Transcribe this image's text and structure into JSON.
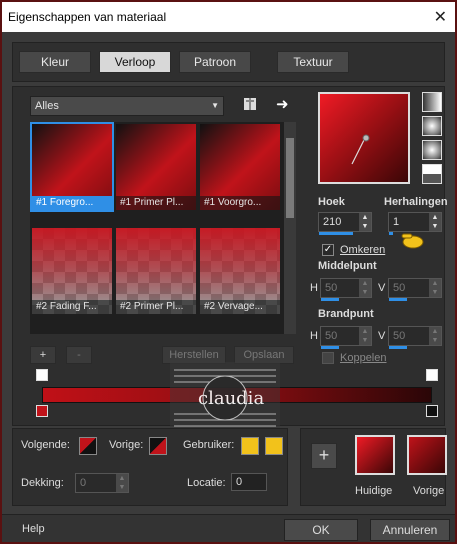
{
  "window": {
    "title": "Eigenschappen van materiaal",
    "close": "✕"
  },
  "tabs": [
    {
      "label": "Kleur"
    },
    {
      "label": "Verloop"
    },
    {
      "label": "Patroon"
    },
    {
      "label": "Textuur"
    }
  ],
  "filter": {
    "selected": "Alles"
  },
  "gradients": [
    {
      "caption": "#1 Foregro..."
    },
    {
      "caption": "#1 Primer Pl..."
    },
    {
      "caption": "#1 Voorgro..."
    },
    {
      "caption": "#2 Fading F..."
    },
    {
      "caption": "#2 Primer Pl..."
    },
    {
      "caption": "#2 Vervage..."
    }
  ],
  "list_buttons": {
    "add": "+",
    "remove": "-",
    "reset": "Herstellen",
    "save": "Opslaan"
  },
  "angle": {
    "label": "Hoek",
    "value": "210"
  },
  "repeats": {
    "label": "Herhalingen",
    "value": "1"
  },
  "invert": {
    "label": "Omkeren",
    "checked": "✓"
  },
  "center": {
    "label": "Middelpunt",
    "h_label": "H",
    "h_value": "50",
    "v_label": "V",
    "v_value": "50"
  },
  "focal": {
    "label": "Brandpunt",
    "h_label": "H",
    "h_value": "50",
    "v_label": "V",
    "v_value": "50"
  },
  "link": {
    "label": "Koppelen"
  },
  "watermark": {
    "text": "claudia"
  },
  "swatch_labels": {
    "next": "Volgende:",
    "prev": "Vorige:",
    "user": "Gebruiker:"
  },
  "opacity": {
    "label": "Dekking:",
    "value": "0"
  },
  "location": {
    "label": "Locatie:",
    "value": "0"
  },
  "preview_labels": {
    "current": "Huidige",
    "previous": "Vorige",
    "add": "+"
  },
  "footer": {
    "help": "Help",
    "ok": "OK",
    "cancel": "Annuleren"
  },
  "colors": {
    "accent": "#2f8fe6",
    "red": "#c0131a",
    "yellow": "#f2c21b"
  }
}
